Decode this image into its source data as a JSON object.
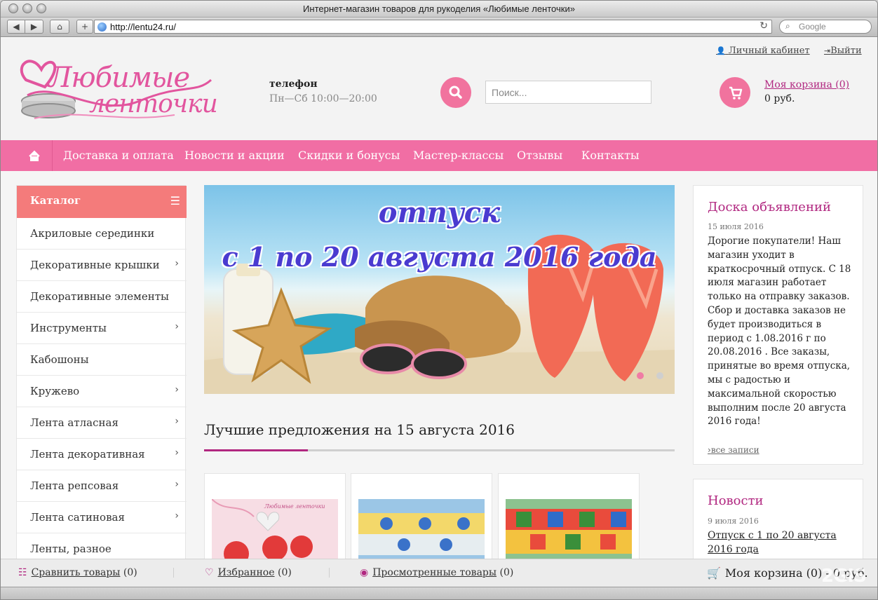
{
  "window": {
    "title": "Интернет-магазин товаров для рукоделия «Любимые ленточки»"
  },
  "toolbar": {
    "back_label": "◀",
    "forward_label": "▶",
    "home_label": "⌂",
    "add_label": "+",
    "url": "http://lentu24.ru/",
    "reload_label": "↻",
    "search_placeholder": "Google"
  },
  "header": {
    "logo_line1": "Любимые",
    "logo_line2": "ленточки",
    "phone_title": "телефон",
    "phone_hours": "Пн—Сб 10:00—20:00",
    "search_placeholder": "Поиск...",
    "cabinet_label": "Личный кабинет",
    "logout_label": "Выйти",
    "cart_label": "Моя корзина (0)",
    "cart_sum": "0 руб."
  },
  "nav": {
    "items": [
      "Доставка и оплата",
      "Новости и акции",
      "Скидки и бонусы",
      "Мастер-классы",
      "Отзывы",
      "Контакты"
    ]
  },
  "catalog": {
    "title": "Каталог",
    "items": [
      {
        "label": "Акриловые серединки",
        "has_children": false
      },
      {
        "label": "Декоративные крышки",
        "has_children": true
      },
      {
        "label": "Декоративные элементы",
        "has_children": false
      },
      {
        "label": "Инструменты",
        "has_children": true
      },
      {
        "label": "Кабошоны",
        "has_children": false
      },
      {
        "label": "Кружево",
        "has_children": true
      },
      {
        "label": "Лента атласная",
        "has_children": true
      },
      {
        "label": "Лента декоративная",
        "has_children": true
      },
      {
        "label": "Лента репсовая",
        "has_children": true
      },
      {
        "label": "Лента сатиновая",
        "has_children": true
      },
      {
        "label": "Ленты, разное",
        "has_children": false
      }
    ]
  },
  "banner": {
    "line1": "отпуск",
    "line2": "с 1 по 20 августа 2016 года",
    "slide_count": 2,
    "active_slide": 1
  },
  "offers": {
    "title": "Лучшие предложения на 15 августа 2016",
    "product_logo_text": "Любимые ленточки"
  },
  "board": {
    "title": "Доска объявлений",
    "date": "15 июля 2016",
    "text": "Дорогие покупатели! Наш магазин уходит в краткосрочный отпуск. С 18 июля магазин работает только на отправку заказов. Сбор и доставка заказов не будет производиться в период с 1.08.2016 г по 20.08.2016 . Все заказы, принятые во время отпуска, мы с радостью и максимальной скоростью выполним после 20 августа 2016 года!",
    "all_label": "все записи"
  },
  "news": {
    "title": "Новости",
    "date": "9 июля 2016",
    "link": "Отпуск с 1 по 20 августа 2016 года"
  },
  "bottombar": {
    "compare_label": "Сравнить товары",
    "compare_count": "(0)",
    "favorites_label": "Избранное",
    "favorites_count": "(0)",
    "viewed_label": "Просмотренные товары",
    "viewed_count": "(0)",
    "cart_label": "Моя корзина (0) - 0 руб."
  },
  "watermark": "2GIS",
  "colors": {
    "accent_pink": "#f16ea4",
    "catalog_header": "#f47b7b",
    "title_magenta": "#b12780"
  }
}
